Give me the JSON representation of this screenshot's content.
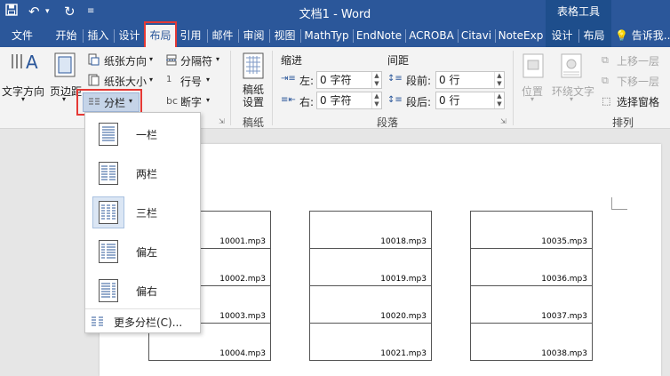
{
  "window": {
    "title": "文档1 - Word",
    "context_group": "表格工具"
  },
  "menu": {
    "tabs": [
      {
        "label": "文件"
      },
      {
        "label": "开始"
      },
      {
        "label": "插入"
      },
      {
        "label": "设计"
      },
      {
        "label": "布局"
      },
      {
        "label": "引用"
      },
      {
        "label": "邮件"
      },
      {
        "label": "审阅"
      },
      {
        "label": "视图"
      },
      {
        "label": "MathTyp"
      },
      {
        "label": "EndNote"
      },
      {
        "label": "ACROBA"
      },
      {
        "label": "Citavi"
      },
      {
        "label": "NoteExp"
      },
      {
        "label": "设计"
      },
      {
        "label": "布局"
      }
    ],
    "tell_me": "告诉我..."
  },
  "ribbon": {
    "page_setup": {
      "text_direction": "文字方向",
      "margins": "页边距",
      "orientation": "纸张方向",
      "size": "纸张大小",
      "columns": "分栏",
      "breaks": "分隔符",
      "line_numbers": "行号",
      "hyphenation": "断字"
    },
    "draft": {
      "label": "稿纸设置",
      "group": "稿纸"
    },
    "paragraph": {
      "indent_title": "缩进",
      "spacing_title": "间距",
      "left_label": "左:",
      "right_label": "右:",
      "left_value": "0 字符",
      "right_value": "0 字符",
      "before_label": "段前:",
      "after_label": "段后:",
      "before_value": "0 行",
      "after_value": "0 行",
      "group": "段落"
    },
    "arrange": {
      "position": "位置",
      "wrap_text": "环绕文字",
      "bring_forward": "上移一层",
      "send_backward": "下移一层",
      "selection_pane": "选择窗格",
      "group": "排列"
    }
  },
  "columns_menu": {
    "options": [
      {
        "label": "一栏"
      },
      {
        "label": "两栏"
      },
      {
        "label": "三栏"
      },
      {
        "label": "偏左"
      },
      {
        "label": "偏右"
      }
    ],
    "selected": "三栏",
    "more": "更多分栏(C)..."
  },
  "document": {
    "columns": [
      {
        "cells": [
          "10001.mp3",
          "10002.mp3",
          "10003.mp3",
          "10004.mp3"
        ]
      },
      {
        "cells": [
          "10018.mp3",
          "10019.mp3",
          "10020.mp3",
          "10021.mp3"
        ]
      },
      {
        "cells": [
          "10035.mp3",
          "10036.mp3",
          "10037.mp3",
          "10038.mp3"
        ]
      }
    ]
  }
}
